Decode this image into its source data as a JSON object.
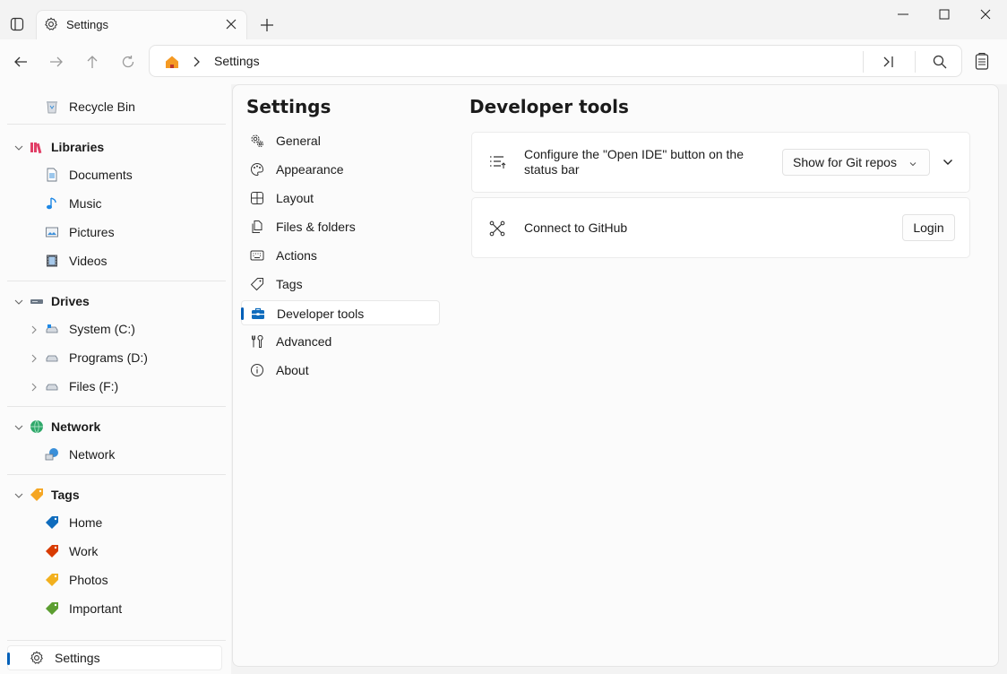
{
  "titlebar": {
    "tab_label": "Settings",
    "icons": {
      "sidepane": "sidepane-icon",
      "tab": "gear-icon",
      "close": "close-icon",
      "new_tab": "plus-icon",
      "minimize": "minimize-icon",
      "maximize": "maximize-icon",
      "window_close": "close-window-icon"
    }
  },
  "toolbar": {
    "address_text": "Settings",
    "icons": [
      "back-icon",
      "forward-icon",
      "up-icon",
      "refresh-icon",
      "home-icon",
      "chevron-right-icon",
      "skip-icon",
      "search-icon",
      "clipboard-icon"
    ]
  },
  "sidebar": {
    "items": [
      {
        "label": "Recycle Bin",
        "icon": "recycle-bin-icon"
      },
      {
        "label": "Libraries",
        "icon": "libraries-icon"
      },
      {
        "label": "Documents",
        "icon": "documents-icon"
      },
      {
        "label": "Music",
        "icon": "music-icon"
      },
      {
        "label": "Pictures",
        "icon": "pictures-icon"
      },
      {
        "label": "Videos",
        "icon": "videos-icon"
      },
      {
        "label": "Drives",
        "icon": "drives-icon"
      },
      {
        "label": "System (C:)",
        "icon": "drive-icon"
      },
      {
        "label": "Programs (D:)",
        "icon": "drive-icon"
      },
      {
        "label": "Files (F:)",
        "icon": "drive-icon"
      },
      {
        "label": "Network",
        "icon": "globe-icon"
      },
      {
        "label": "Network",
        "icon": "network-icon"
      },
      {
        "label": "Tags",
        "icon": "tag-icon"
      },
      {
        "label": "Home",
        "icon": "tag-icon",
        "color": "#0f6cbd"
      },
      {
        "label": "Work",
        "icon": "tag-icon",
        "color": "#d83b01"
      },
      {
        "label": "Photos",
        "icon": "tag-icon",
        "color": "#f2b01e"
      },
      {
        "label": "Important",
        "icon": "tag-icon",
        "color": "#5c9e31"
      }
    ],
    "settings_label": "Settings"
  },
  "settings": {
    "title": "Settings",
    "menu": [
      {
        "label": "General",
        "icon": "gears-icon"
      },
      {
        "label": "Appearance",
        "icon": "palette-icon"
      },
      {
        "label": "Layout",
        "icon": "layout-icon"
      },
      {
        "label": "Files & folders",
        "icon": "files-icon"
      },
      {
        "label": "Actions",
        "icon": "keyboard-icon"
      },
      {
        "label": "Tags",
        "icon": "tag-outline-icon"
      },
      {
        "label": "Developer tools",
        "icon": "toolbox-icon"
      },
      {
        "label": "Advanced",
        "icon": "wrench-icon"
      },
      {
        "label": "About",
        "icon": "info-icon"
      }
    ],
    "active_item": "Developer tools"
  },
  "developer_tools": {
    "title": "Developer tools",
    "open_ide": {
      "label": "Configure the \"Open IDE\" button on the status bar",
      "value": "Show for Git repos",
      "icon": "list-settings-icon"
    },
    "github": {
      "label": "Connect to GitHub",
      "button": "Login",
      "icon": "github-connect-icon"
    }
  },
  "colors": {
    "accent": "#005fb8",
    "home_icon": "#f59a23",
    "libraries_icon": "#e13e66"
  }
}
